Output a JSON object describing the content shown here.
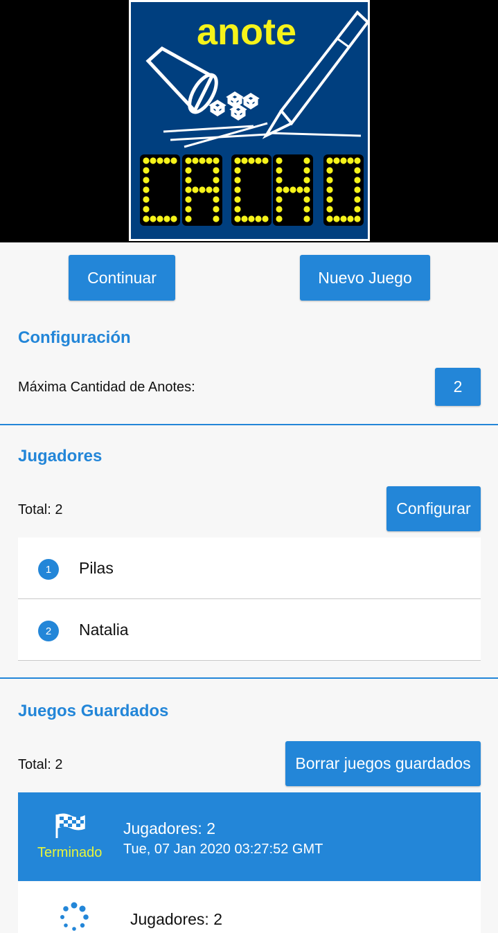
{
  "logo": {
    "word": "anote",
    "game_name": "CACHO"
  },
  "actions": {
    "continue_label": "Continuar",
    "new_game_label": "Nuevo Juego"
  },
  "config": {
    "title": "Configuración",
    "max_label": "Máxima Cantidad de Anotes:",
    "max_value": "2"
  },
  "players": {
    "title": "Jugadores",
    "total": "Total: 2",
    "configure_label": "Configurar",
    "items": [
      {
        "num": "1",
        "name": "Pilas"
      },
      {
        "num": "2",
        "name": "Natalia"
      }
    ]
  },
  "saved": {
    "title": "Juegos Guardados",
    "total": "Total: 2",
    "delete_label": "Borrar juegos guardados",
    "games": [
      {
        "status": "Terminado",
        "players": "Jugadores: 2",
        "date": "Tue, 07 Jan 2020 03:27:52 GMT",
        "icon": "checkered-flag-icon"
      },
      {
        "status": "",
        "players": "Jugadores: 2",
        "date": "",
        "icon": "loading-spinner-icon"
      }
    ]
  },
  "colors": {
    "accent": "#2386d8",
    "logo_bg": "#003f7f",
    "led_yellow": "#f6f31a"
  }
}
